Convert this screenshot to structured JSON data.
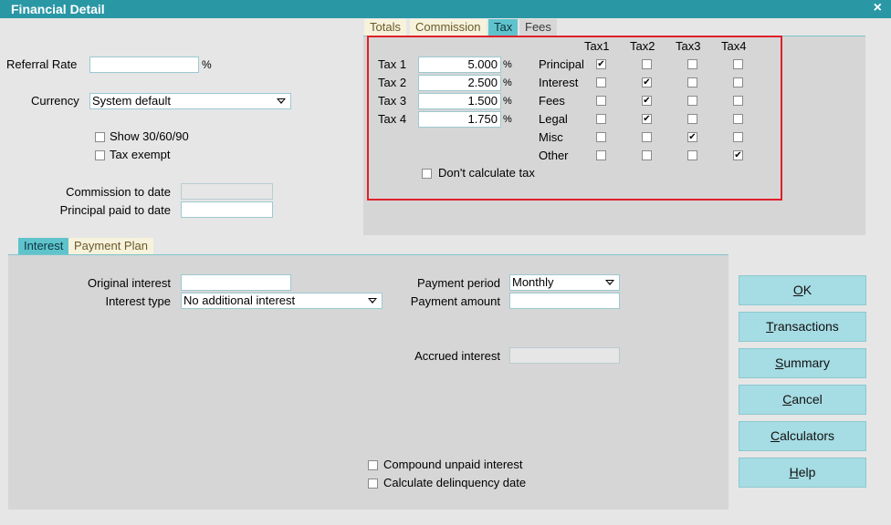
{
  "window": {
    "title": "Financial Detail",
    "close_glyph": "×"
  },
  "general": {
    "referral_rate_label": "Referral Rate",
    "referral_rate_value": "",
    "percent_sign": "%",
    "currency_label": "Currency",
    "currency_value": "System default",
    "show_30_60_90_label": "Show 30/60/90",
    "show_30_60_90_checked": false,
    "tax_exempt_label": "Tax exempt",
    "tax_exempt_checked": false,
    "commission_to_date_label": "Commission to date",
    "commission_to_date_value": "",
    "principal_paid_label": "Principal paid to date",
    "principal_paid_value": ""
  },
  "top_tabs": [
    "Totals",
    "Commission",
    "Tax",
    "Fees"
  ],
  "top_tabs_active": "Tax",
  "tax": {
    "rates": [
      {
        "label": "Tax 1",
        "value": "5.000",
        "unit": "%"
      },
      {
        "label": "Tax 2",
        "value": "2.500",
        "unit": "%"
      },
      {
        "label": "Tax 3",
        "value": "1.500",
        "unit": "%"
      },
      {
        "label": "Tax 4",
        "value": "1.750",
        "unit": "%"
      }
    ],
    "columns": [
      "Tax1",
      "Tax2",
      "Tax3",
      "Tax4"
    ],
    "rows": [
      {
        "label": "Principal",
        "checks": [
          true,
          false,
          false,
          false
        ]
      },
      {
        "label": "Interest",
        "checks": [
          false,
          true,
          false,
          false
        ]
      },
      {
        "label": "Fees",
        "checks": [
          false,
          true,
          false,
          false
        ]
      },
      {
        "label": "Legal",
        "checks": [
          false,
          true,
          false,
          false
        ]
      },
      {
        "label": "Misc",
        "checks": [
          false,
          false,
          true,
          false
        ]
      },
      {
        "label": "Other",
        "checks": [
          false,
          false,
          false,
          true
        ]
      }
    ],
    "dont_calculate_label": "Don't calculate tax",
    "dont_calculate_checked": false
  },
  "bottom_tabs": [
    "Interest",
    "Payment Plan"
  ],
  "bottom_tabs_active": "Interest",
  "interest": {
    "original_interest_label": "Original interest",
    "original_interest_value": "",
    "interest_type_label": "Interest type",
    "interest_type_value": "No additional interest",
    "payment_period_label": "Payment period",
    "payment_period_value": "Monthly",
    "payment_amount_label": "Payment amount",
    "payment_amount_value": "",
    "accrued_interest_label": "Accrued interest",
    "accrued_interest_value": "",
    "compound_label": "Compound unpaid interest",
    "compound_checked": false,
    "delinquency_label": "Calculate delinquency date",
    "delinquency_checked": false
  },
  "buttons": [
    {
      "name": "ok",
      "mnemonic": "O",
      "rest": "K"
    },
    {
      "name": "transactions",
      "mnemonic": "T",
      "rest": "ransactions"
    },
    {
      "name": "summary",
      "mnemonic": "S",
      "rest": "ummary"
    },
    {
      "name": "cancel",
      "mnemonic": "C",
      "rest": "ancel"
    },
    {
      "name": "calculators",
      "mnemonic": "C",
      "rest": "alculators"
    },
    {
      "name": "help",
      "mnemonic": "H",
      "rest": "elp"
    }
  ],
  "colors": {
    "titlebar": "#2a97a5",
    "tab_active": "#5fc3cc",
    "button": "#a6dce3",
    "highlight_box": "#e0202a"
  }
}
